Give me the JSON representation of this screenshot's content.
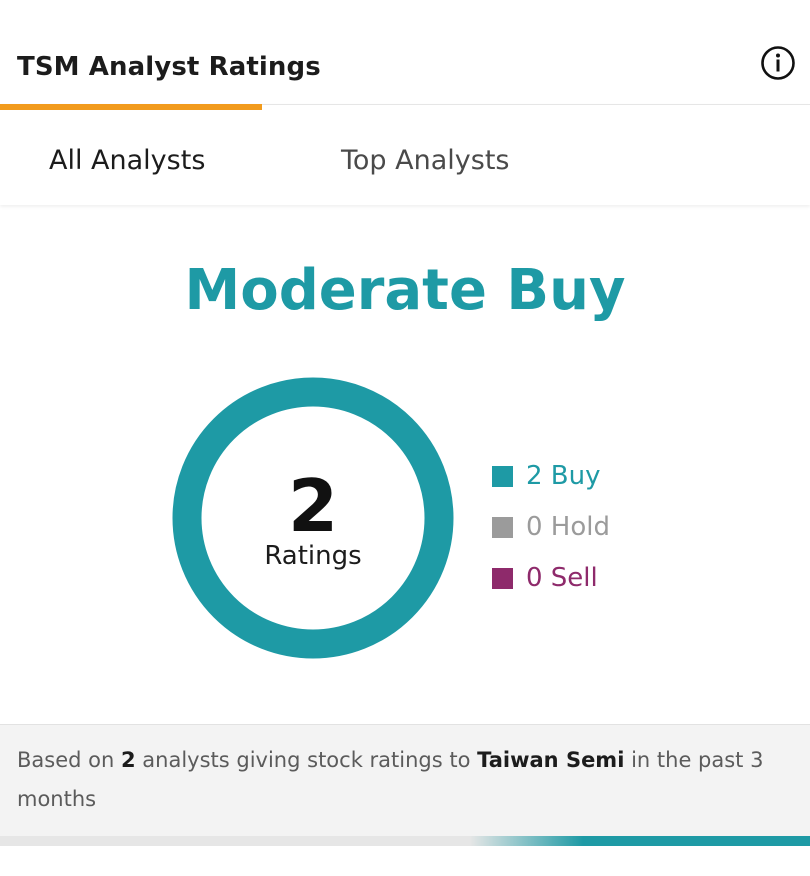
{
  "header": {
    "title": "TSM Analyst Ratings",
    "info_icon": "info-circle-icon"
  },
  "tabs": [
    {
      "label": "All Analysts",
      "active": true
    },
    {
      "label": "Top Analysts",
      "active": false
    }
  ],
  "consensus": {
    "label": "Moderate Buy",
    "color": "#1e9aa5"
  },
  "donut": {
    "count": "2",
    "label": "Ratings"
  },
  "legend": [
    {
      "label": "2 Buy",
      "count": 2,
      "color": "#1e9aa5"
    },
    {
      "label": "0 Hold",
      "count": 0,
      "color": "#9b9b9b"
    },
    {
      "label": "0 Sell",
      "count": 0,
      "color": "#8e2a6b"
    }
  ],
  "footer": {
    "prefix": "Based on ",
    "analyst_count": "2",
    "middle": " analysts giving stock ratings to ",
    "company": "Taiwan Semi",
    "suffix": " in the past 3 months"
  },
  "accent_colors": {
    "tab_indicator": "#f29b1d",
    "buy": "#1e9aa5",
    "hold": "#9b9b9b",
    "sell": "#8e2a6b"
  }
}
